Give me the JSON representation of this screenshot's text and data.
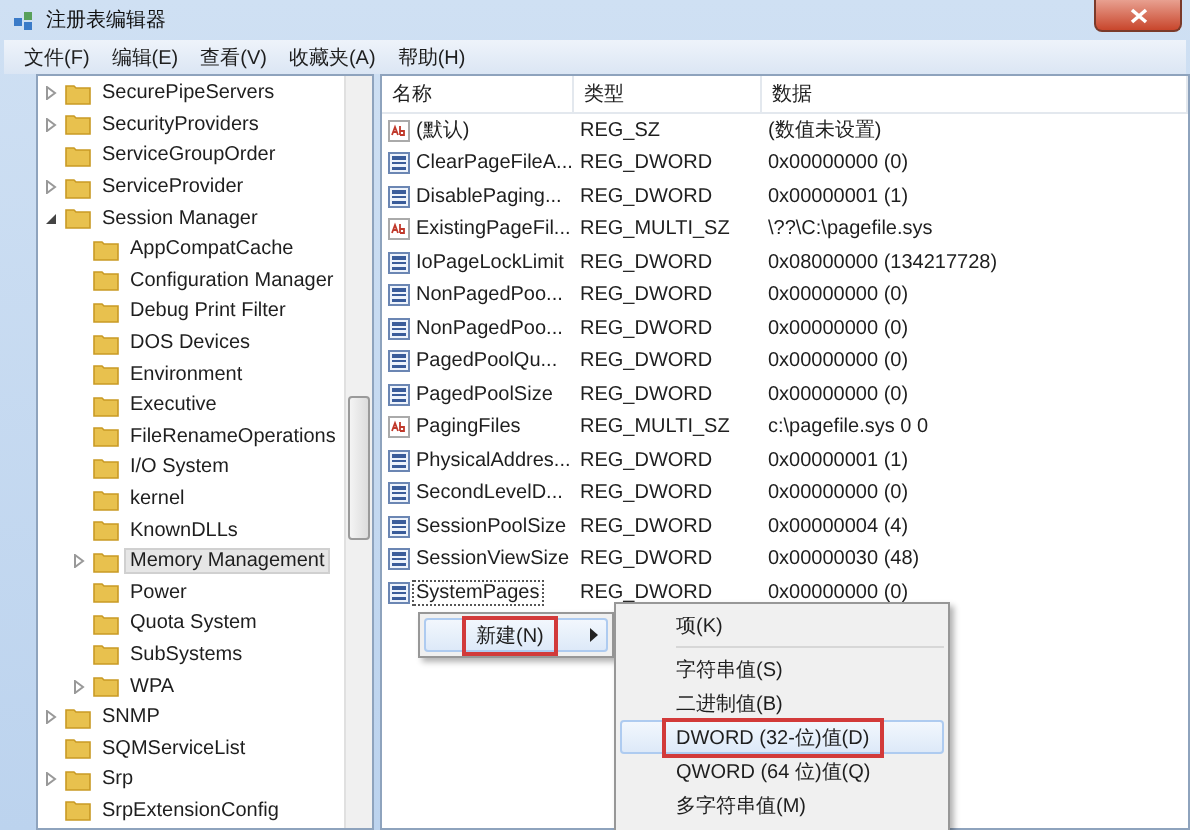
{
  "window": {
    "title": "注册表编辑器"
  },
  "menu_bar": [
    "文件(F)",
    "编辑(E)",
    "查看(V)",
    "收藏夹(A)",
    "帮助(H)"
  ],
  "tree": [
    {
      "label": "SecurePipeServers",
      "kind": "node",
      "expanded": false,
      "selected": false
    },
    {
      "label": "SecurityProviders",
      "kind": "node",
      "expanded": false,
      "selected": false
    },
    {
      "label": "ServiceGroupOrder",
      "kind": "leaf",
      "selected": false
    },
    {
      "label": "ServiceProvider",
      "kind": "node",
      "expanded": false,
      "selected": false
    },
    {
      "label": "Session Manager",
      "kind": "node",
      "expanded": true,
      "selected": false,
      "children": [
        {
          "label": "AppCompatCache",
          "kind": "leaf",
          "selected": false
        },
        {
          "label": "Configuration Manager",
          "kind": "leaf",
          "selected": false
        },
        {
          "label": "Debug Print Filter",
          "kind": "leaf",
          "selected": false
        },
        {
          "label": "DOS Devices",
          "kind": "leaf",
          "selected": false
        },
        {
          "label": "Environment",
          "kind": "leaf",
          "selected": false
        },
        {
          "label": "Executive",
          "kind": "leaf",
          "selected": false
        },
        {
          "label": "FileRenameOperations",
          "kind": "leaf",
          "selected": false
        },
        {
          "label": "I/O System",
          "kind": "leaf",
          "selected": false
        },
        {
          "label": "kernel",
          "kind": "leaf",
          "selected": false
        },
        {
          "label": "KnownDLLs",
          "kind": "leaf",
          "selected": false
        },
        {
          "label": "Memory Management",
          "kind": "node",
          "expanded": false,
          "selected": true
        },
        {
          "label": "Power",
          "kind": "leaf",
          "selected": false
        },
        {
          "label": "Quota System",
          "kind": "leaf",
          "selected": false
        },
        {
          "label": "SubSystems",
          "kind": "leaf",
          "selected": false
        },
        {
          "label": "WPA",
          "kind": "node",
          "expanded": false,
          "selected": false
        }
      ]
    },
    {
      "label": "SNMP",
      "kind": "node",
      "expanded": false,
      "selected": false
    },
    {
      "label": "SQMServiceList",
      "kind": "leaf",
      "selected": false
    },
    {
      "label": "Srp",
      "kind": "node",
      "expanded": false,
      "selected": false
    },
    {
      "label": "SrpExtensionConfig",
      "kind": "leaf",
      "selected": false
    }
  ],
  "table": {
    "columns": [
      "名称",
      "类型",
      "数据"
    ],
    "rows": [
      {
        "kind": "string",
        "name": "(默认)",
        "type": "REG_SZ",
        "data": "(数值未设置)",
        "focused": false
      },
      {
        "kind": "binary",
        "name": "ClearPageFileA...",
        "type": "REG_DWORD",
        "data": "0x00000000 (0)",
        "focused": false
      },
      {
        "kind": "binary",
        "name": "DisablePaging...",
        "type": "REG_DWORD",
        "data": "0x00000001 (1)",
        "focused": false
      },
      {
        "kind": "string",
        "name": "ExistingPageFil...",
        "type": "REG_MULTI_SZ",
        "data": "\\??\\C:\\pagefile.sys",
        "focused": false
      },
      {
        "kind": "binary",
        "name": "IoPageLockLimit",
        "type": "REG_DWORD",
        "data": "0x08000000 (134217728)",
        "focused": false
      },
      {
        "kind": "binary",
        "name": "NonPagedPoo...",
        "type": "REG_DWORD",
        "data": "0x00000000 (0)",
        "focused": false
      },
      {
        "kind": "binary",
        "name": "NonPagedPoo...",
        "type": "REG_DWORD",
        "data": "0x00000000 (0)",
        "focused": false
      },
      {
        "kind": "binary",
        "name": "PagedPoolQu...",
        "type": "REG_DWORD",
        "data": "0x00000000 (0)",
        "focused": false
      },
      {
        "kind": "binary",
        "name": "PagedPoolSize",
        "type": "REG_DWORD",
        "data": "0x00000000 (0)",
        "focused": false
      },
      {
        "kind": "string",
        "name": "PagingFiles",
        "type": "REG_MULTI_SZ",
        "data": "c:\\pagefile.sys 0 0",
        "focused": false
      },
      {
        "kind": "binary",
        "name": "PhysicalAddres...",
        "type": "REG_DWORD",
        "data": "0x00000001 (1)",
        "focused": false
      },
      {
        "kind": "binary",
        "name": "SecondLevelD...",
        "type": "REG_DWORD",
        "data": "0x00000000 (0)",
        "focused": false
      },
      {
        "kind": "binary",
        "name": "SessionPoolSize",
        "type": "REG_DWORD",
        "data": "0x00000004 (4)",
        "focused": false
      },
      {
        "kind": "binary",
        "name": "SessionViewSize",
        "type": "REG_DWORD",
        "data": "0x00000030 (48)",
        "focused": false
      },
      {
        "kind": "binary",
        "name": "SystemPages",
        "type": "REG_DWORD",
        "data": "0x00000000 (0)",
        "focused": true
      }
    ]
  },
  "context_menu": {
    "items": [
      {
        "label": "新建(N)",
        "submenu": true,
        "selected": true,
        "marked": true
      }
    ]
  },
  "submenu": {
    "items": [
      {
        "kind": "item",
        "label": "项(K)",
        "selected": false,
        "marked": false
      },
      {
        "kind": "separator"
      },
      {
        "kind": "item",
        "label": "字符串值(S)",
        "selected": false,
        "marked": false
      },
      {
        "kind": "item",
        "label": "二进制值(B)",
        "selected": false,
        "marked": false
      },
      {
        "kind": "item",
        "label": "DWORD (32-位)值(D)",
        "selected": true,
        "marked": true
      },
      {
        "kind": "item",
        "label": "QWORD (64 位)值(Q)",
        "selected": false,
        "marked": false
      },
      {
        "kind": "item",
        "label": "多字符串值(M)",
        "selected": false,
        "marked": false
      }
    ]
  }
}
